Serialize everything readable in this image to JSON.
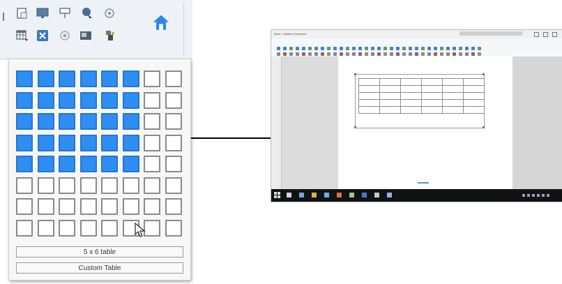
{
  "ribbon": {
    "row1_icons": [
      "blank-page-icon",
      "monitor-icon",
      "network-icon",
      "users-icon",
      "globe-icon"
    ],
    "row2_icons": [
      "insert-table-icon",
      "close-box-icon",
      "camera-icon",
      "image-icon",
      "sound-icon"
    ],
    "big_icon": "home-icon"
  },
  "table_picker": {
    "rows": 8,
    "cols": 8,
    "selected_rows": 5,
    "selected_cols": 6,
    "size_label": "5 x 6 table",
    "custom_label": "Custom Table"
  },
  "thumbnail": {
    "title": "Word - Untitled Document",
    "inserted_table": {
      "rows": 5,
      "cols": 6
    }
  },
  "colors": {
    "selected_cell": "#2f8ef2",
    "taskbar": "#101214",
    "accent": "#2a8ae8"
  }
}
